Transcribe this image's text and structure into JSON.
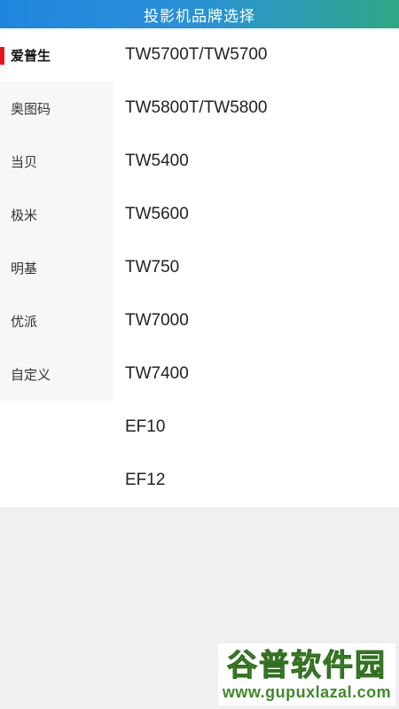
{
  "header": {
    "title": "投影机品牌选择"
  },
  "sidebar": {
    "items": [
      {
        "label": "爱普生",
        "selected": true
      },
      {
        "label": "奥图码",
        "selected": false
      },
      {
        "label": "当贝",
        "selected": false
      },
      {
        "label": "极米",
        "selected": false
      },
      {
        "label": "明基",
        "selected": false
      },
      {
        "label": "优派",
        "selected": false
      },
      {
        "label": "自定义",
        "selected": false
      }
    ]
  },
  "models": {
    "items": [
      {
        "label": "TW5700T/TW5700"
      },
      {
        "label": "TW5800T/TW5800"
      },
      {
        "label": "TW5400"
      },
      {
        "label": "TW5600"
      },
      {
        "label": "TW750"
      },
      {
        "label": "TW7000"
      },
      {
        "label": "TW7400"
      },
      {
        "label": "EF10"
      },
      {
        "label": "EF12"
      }
    ]
  },
  "watermark": {
    "title": "谷普软件园",
    "url": "www.gupuxlazal.com"
  },
  "colors": {
    "header_gradient_start": "#1f86de",
    "header_gradient_end": "#2fa784",
    "active_marker": "#e8141b",
    "page_background": "#f0f0f0",
    "watermark_green": "#5aa03a"
  }
}
